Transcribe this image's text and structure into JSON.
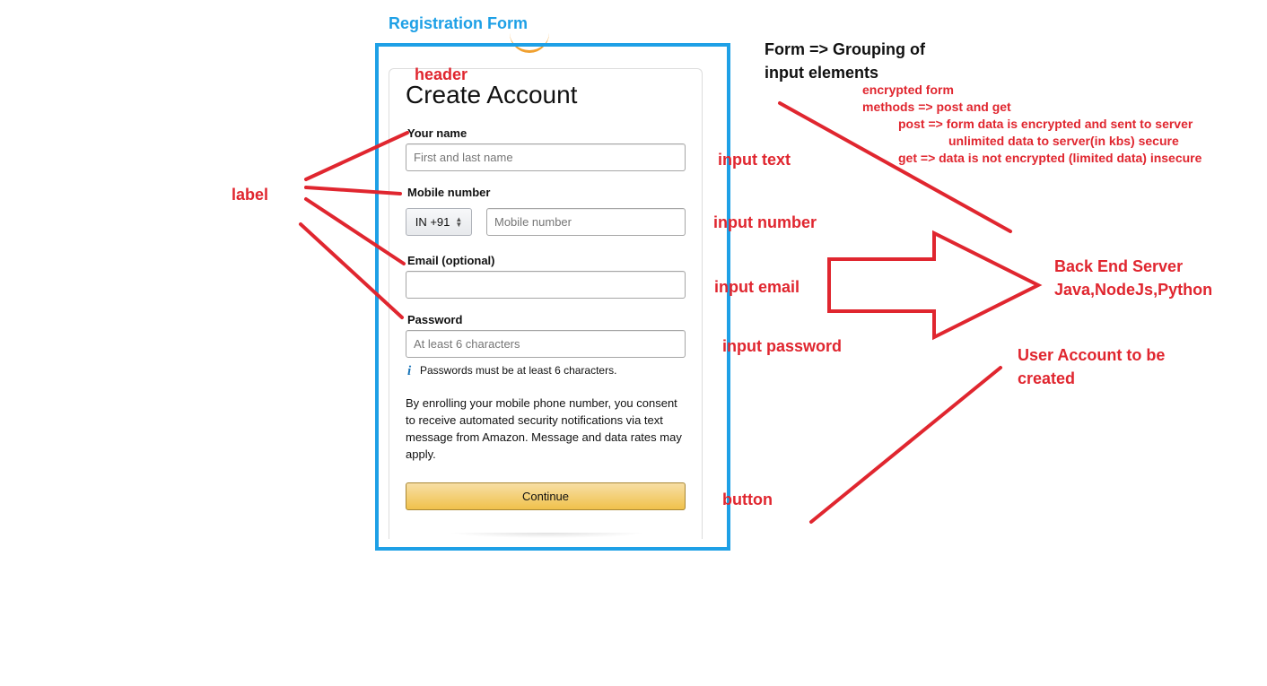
{
  "annotations": {
    "title": "Registration Form",
    "header": "header",
    "label": "label",
    "input_text": "input text",
    "input_number": "input number",
    "input_email": "input email",
    "input_password": "input password",
    "button": "button",
    "form_line1": "Form => Grouping of",
    "form_line2": "input elements",
    "encrypted_form": "encrypted form",
    "methods": "methods => post and get",
    "post": "post => form data is encrypted and sent to server",
    "post_cont": "unlimited data to server(in kbs) secure",
    "get": "get => data is not encrypted (limited data) insecure",
    "server_line1": "Back End Server",
    "server_line2": "Java,NodeJs,Python",
    "account_line1": "User Account to be",
    "account_line2": "created"
  },
  "form": {
    "title": "Create Account",
    "name_label": "Your name",
    "name_placeholder": "First and last name",
    "mobile_label": "Mobile number",
    "country_code": "IN +91",
    "mobile_placeholder": "Mobile number",
    "email_label": "Email (optional)",
    "password_label": "Password",
    "password_placeholder": "At least 6 characters",
    "password_hint_icon": "i",
    "password_hint": "Passwords must be at least 6 characters.",
    "consent": "By enrolling your mobile phone number, you consent to receive automated security notifications via text message from Amazon. Message and data rates may apply.",
    "continue_label": "Continue"
  },
  "colors": {
    "annotation_red": "#e0262f",
    "frame_blue": "#1ea0e6",
    "button_gold": "#f0c14b"
  }
}
